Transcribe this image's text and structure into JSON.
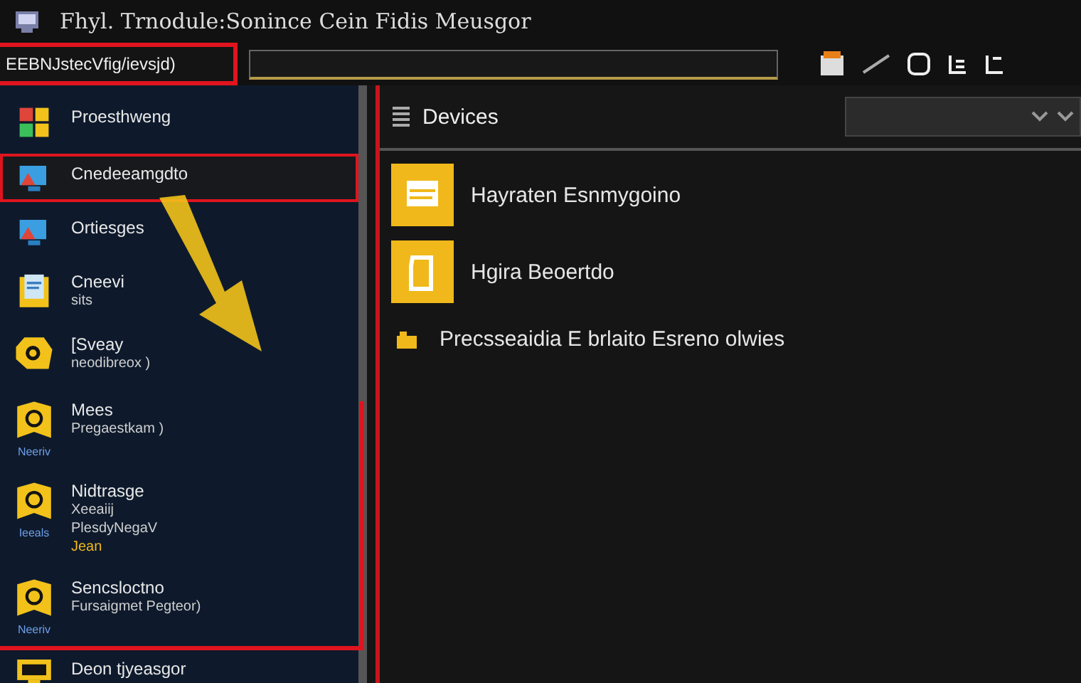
{
  "window": {
    "title": "Fhyl. Trnodule:Sonince Cein Fidis Meusgor"
  },
  "address": {
    "value": "EEBNJstecVfig/ievsjd)"
  },
  "sidebar": {
    "items": [
      {
        "kind": "windows",
        "label": "Proesthweng",
        "selected": false
      },
      {
        "kind": "monitor",
        "label": "Cnedeeamgdto",
        "selected": true
      },
      {
        "kind": "monitor",
        "label": "Ortiesges",
        "selected": false
      },
      {
        "kind": "folder",
        "label": "Cneevi",
        "sub": "sits",
        "selected": false
      },
      {
        "kind": "gear",
        "label": "[Sveay",
        "sub": "neodibreox )",
        "selected": false
      },
      {
        "kind": "badge",
        "label": "Mees",
        "sub": "Pregaestkam )",
        "tag": "Neeriv",
        "selected": false
      },
      {
        "kind": "badge",
        "label": "Nidtrasge",
        "sub": "Xeeaiij",
        "sub2": "PlesdyNegaV",
        "tag": "Ieeals",
        "note": "Jean",
        "selected": false
      },
      {
        "kind": "badge",
        "label": "Sencsloctno",
        "sub": "Fursaigmet Pegteor)",
        "tag": "Neeriv",
        "selected": false
      },
      {
        "kind": "display",
        "label": "Deon tjyeasgor",
        "selected": false
      }
    ]
  },
  "panel": {
    "title": "Devices",
    "items": [
      {
        "kind": "card",
        "label": "Hayraten Esnmygoino"
      },
      {
        "kind": "doc",
        "label": "Hgira Beoertdo"
      },
      {
        "kind": "small",
        "label": "Precsseaidia E brlaito Esreno olwies"
      }
    ]
  }
}
